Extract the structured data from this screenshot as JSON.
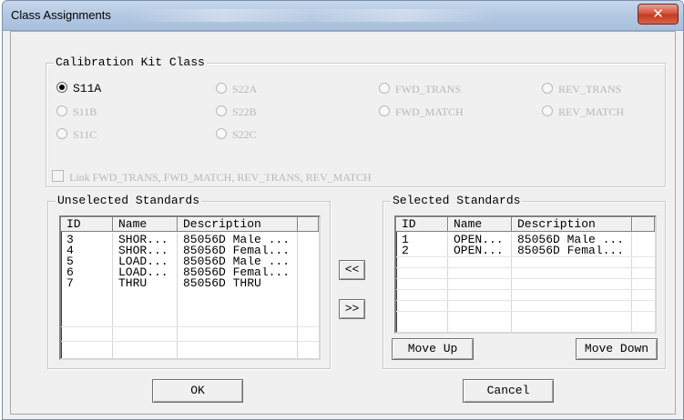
{
  "window": {
    "title": "Class Assignments",
    "close_glyph": "✕"
  },
  "kit_class": {
    "legend": "Calibration Kit Class",
    "options": [
      {
        "label": "S11A",
        "selected": true,
        "enabled": true
      },
      {
        "label": "S22A",
        "selected": false,
        "enabled": false
      },
      {
        "label": "FWD_TRANS",
        "selected": false,
        "enabled": false
      },
      {
        "label": "REV_TRANS",
        "selected": false,
        "enabled": false
      },
      {
        "label": "S11B",
        "selected": false,
        "enabled": false
      },
      {
        "label": "S22B",
        "selected": false,
        "enabled": false
      },
      {
        "label": "FWD_MATCH",
        "selected": false,
        "enabled": false
      },
      {
        "label": "REV_MATCH",
        "selected": false,
        "enabled": false
      },
      {
        "label": "S11C",
        "selected": false,
        "enabled": false
      },
      {
        "label": "S22C",
        "selected": false,
        "enabled": false
      }
    ],
    "link_checkbox": {
      "label": "Link FWD_TRANS, FWD_MATCH, REV_TRANS, REV_MATCH",
      "checked": false,
      "enabled": false
    }
  },
  "unselected": {
    "legend": "Unselected Standards",
    "columns": [
      "ID",
      "Name",
      "Description"
    ],
    "rows": [
      [
        "3",
        "SHOR...",
        "85056D Male ..."
      ],
      [
        "4",
        "SHOR...",
        "85056D Femal..."
      ],
      [
        "5",
        "LOAD...",
        "85056D Male ..."
      ],
      [
        "6",
        "LOAD...",
        "85056D Femal..."
      ],
      [
        "7",
        "THRU",
        "85056D THRU"
      ]
    ]
  },
  "move_buttons": {
    "to_selected_left": "<<",
    "to_unselected_right": ">>"
  },
  "selected": {
    "legend": "Selected Standards",
    "columns": [
      "ID",
      "Name",
      "Description"
    ],
    "rows": [
      [
        "1",
        "OPEN...",
        "85056D Male ..."
      ],
      [
        "2",
        "OPEN...",
        "85056D Femal..."
      ]
    ],
    "move_up": "Move Up",
    "move_down": "Move Down"
  },
  "footer": {
    "ok": "OK",
    "cancel": "Cancel"
  },
  "colors": {
    "title_bar": "#b3c8e2",
    "close_button": "#c43a20",
    "disabled_text": "#b8b8b8"
  }
}
